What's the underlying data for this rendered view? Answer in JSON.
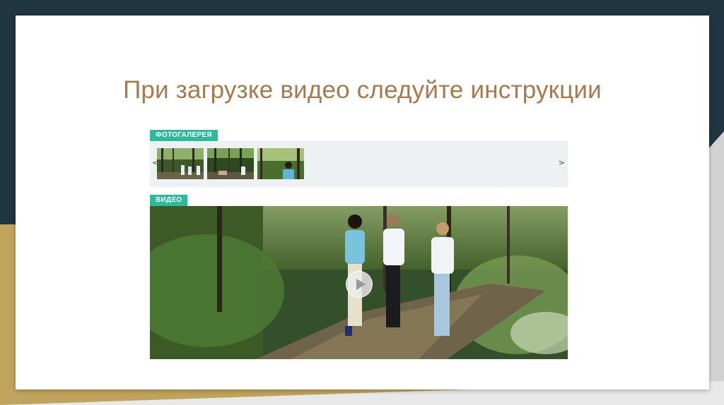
{
  "slide": {
    "title": "При загрузке видео следуйте инструкции"
  },
  "gallery": {
    "label": "ФОТОГАЛЕРЕЯ",
    "prev_arrow": "<",
    "next_arrow": ">",
    "thumbnails": [
      "thumbnail-1",
      "thumbnail-2",
      "thumbnail-3"
    ]
  },
  "video": {
    "label": "ВИДЕО",
    "play_icon": "play-icon"
  },
  "colors": {
    "background": "#1f3542",
    "accent_gold": "#c0a35c",
    "title_color": "#a6794f",
    "tag_color": "#2fb89a",
    "gallery_bg": "#edf1f4"
  }
}
